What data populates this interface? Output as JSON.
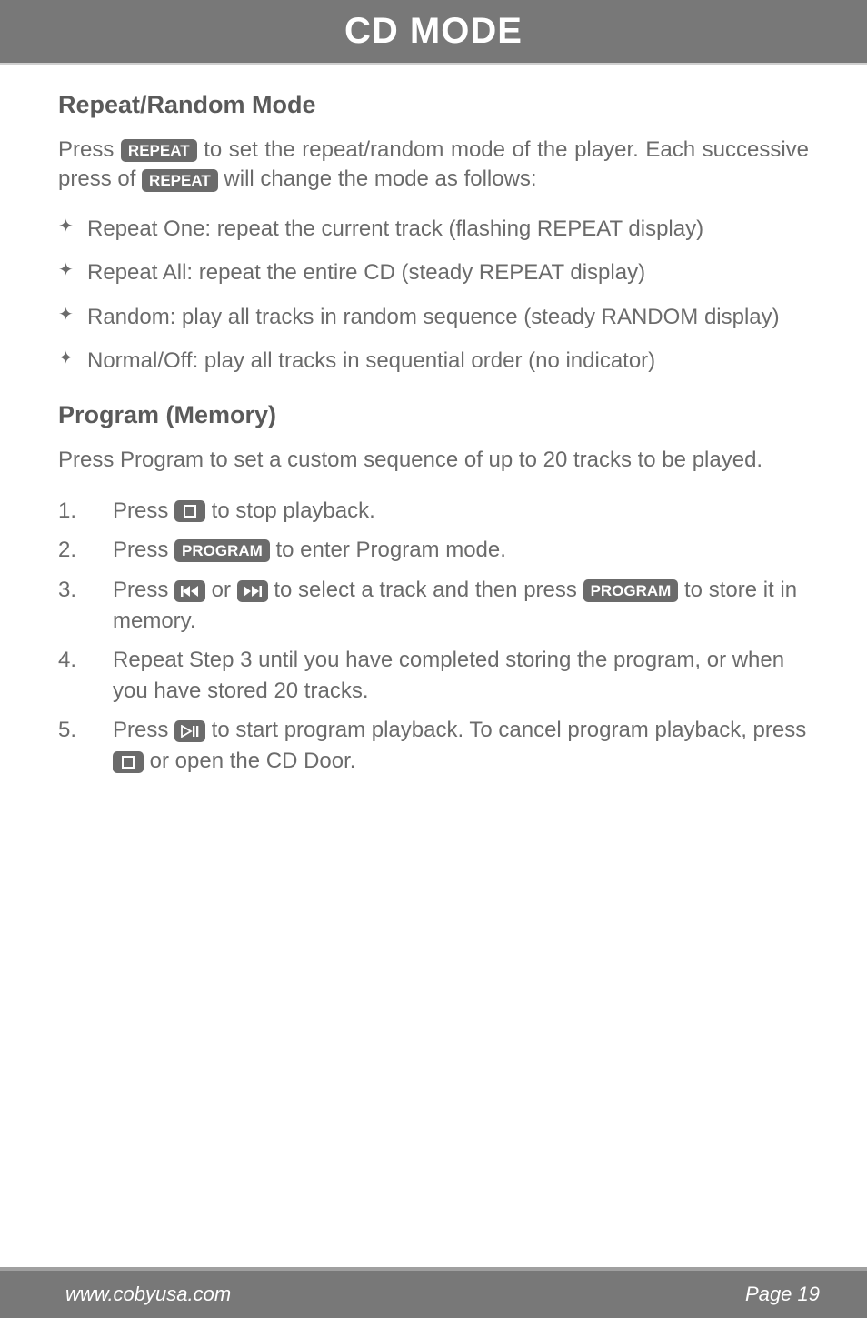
{
  "header": {
    "title": "CD MODE"
  },
  "section1": {
    "heading": "Repeat/Random Mode",
    "para_parts": {
      "p1": "Press ",
      "badge1": "REPEAT",
      "p2": " to set the repeat/random mode of the player. Each successive press of ",
      "badge2": "REPEAT",
      "p3": " will change the mode as follows:"
    },
    "bullets": [
      "Repeat One: repeat the current track (flashing REPEAT display)",
      "Repeat All: repeat the entire CD (steady REPEAT display)",
      "Random: play all tracks in random sequence (steady RANDOM display)",
      "Normal/Off: play all tracks in sequential order (no indicator)"
    ]
  },
  "section2": {
    "heading": "Program (Memory)",
    "para": "Press Program to set a custom sequence of up to 20 tracks to be played.",
    "steps": {
      "s1": {
        "num": "1.",
        "pre": "Press ",
        "post": " to stop playback."
      },
      "s2": {
        "num": "2.",
        "pre": "Press ",
        "badge": "PROGRAM",
        "post": " to enter Program mode."
      },
      "s3": {
        "num": "3.",
        "pre": "Press ",
        "mid": " or ",
        "mid2": "  to select a track and then press ",
        "badge": "PROGRAM",
        "post": " to store it in memory."
      },
      "s4": {
        "num": "4.",
        "text": "Repeat Step 3 until you have completed storing the program, or when you have stored 20 tracks."
      },
      "s5": {
        "num": "5.",
        "pre": "Press ",
        "mid": " to start program playback. To cancel program playback, press ",
        "post": " or open the CD Door."
      }
    }
  },
  "footer": {
    "url": "www.cobyusa.com",
    "page": "Page 19"
  }
}
